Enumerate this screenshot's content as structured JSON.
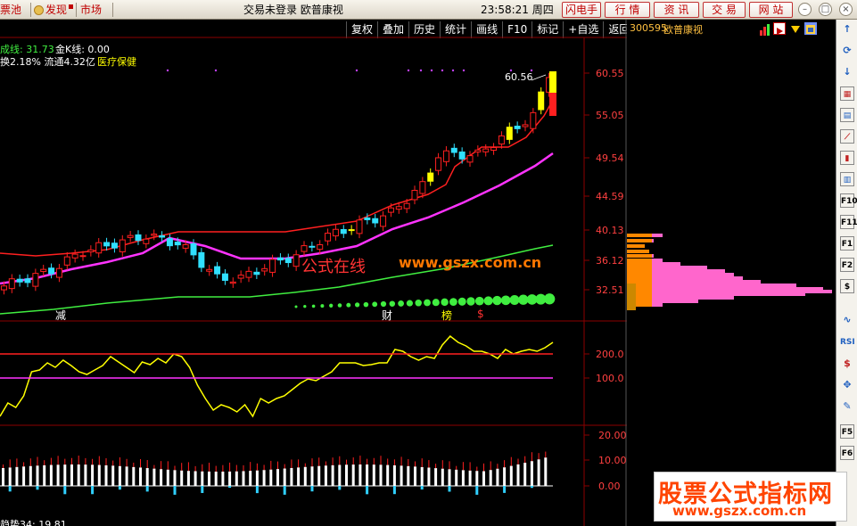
{
  "topbar": {
    "tab_pool": "票池",
    "tab_discover": "发现",
    "tab_market": "市场",
    "title": "交易未登录  欧普康视",
    "clock": "23:58:21 周四",
    "buttons": [
      "闪电手",
      "行  情",
      "资  讯",
      "交  易",
      "网  站"
    ]
  },
  "toolbar": {
    "items": [
      "复权",
      "叠加",
      "历史",
      "统计",
      "画线",
      "F10",
      "标记",
      "+自选",
      "返回"
    ]
  },
  "info": {
    "line1_a": "成线: 31.73",
    "line1_b": "金K线: 0.00",
    "line2_a": "换2.18% 流通4.32亿",
    "line2_b": "医疗保健"
  },
  "price_axis": [
    "60.55",
    "55.05",
    "49.54",
    "44.59",
    "40.13",
    "36.12",
    "32.51"
  ],
  "peak_label": "60.56",
  "markers": [
    {
      "text": "减",
      "color": "#ffffff"
    },
    {
      "text": "财",
      "color": "#ffffff"
    },
    {
      "text": "榜",
      "color": "#ffff00"
    },
    {
      "text": "$",
      "color": "#ff3030"
    }
  ],
  "osc_axis": [
    "200.0",
    "100.0"
  ],
  "macd_axis": [
    "20.00",
    "10.00",
    "0.00"
  ],
  "bottom_label": "趋势34: 19.81",
  "stock": {
    "code": "300595",
    "name": "欧普康视"
  },
  "watermark": {
    "chart_text": "公式在线",
    "chart_url": "www.gszx.com.cn",
    "box_title": "股票公式指标网",
    "box_url": "www.gszx.com.cn"
  },
  "sidebar_icons": [
    "up-arrow-icon",
    "rotate-icon",
    "down-arrow-icon",
    "grid-icon",
    "list-icon",
    "line-chart-icon",
    "candle-icon",
    "bars-icon",
    "f10-icon",
    "f11-icon",
    "f1-icon",
    "f2-icon",
    "dollar-circle-icon",
    "wave-icon",
    "rsi-icon",
    "dollar-icon",
    "move-icon",
    "pencil-icon",
    "f5-icon",
    "f6-icon"
  ],
  "colors": {
    "up": "#ff2020",
    "down": "#30e0ff",
    "yellow": "#ffff00",
    "magenta": "#ff33ff",
    "green": "#40ee40",
    "red_line": "#ff2020",
    "grid": "#8b0000"
  }
}
